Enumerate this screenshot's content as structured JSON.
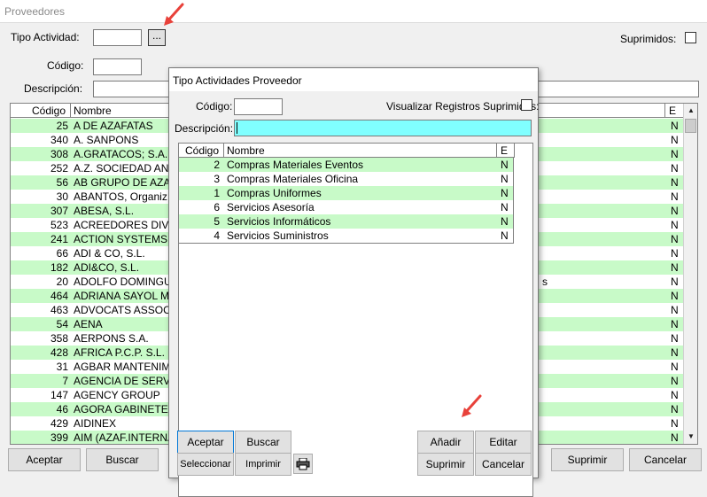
{
  "window": {
    "title": "Proveedores"
  },
  "filters": {
    "tipo_actividad_label": "Tipo Actividad:",
    "tipo_actividad_value": "",
    "browse_label": "...",
    "suprimidos_label": "Suprimidos:",
    "codigo_label": "Código:",
    "codigo_value": "",
    "descripcion_label": "Descripción:",
    "descripcion_value": ""
  },
  "grid": {
    "headers": {
      "codigo": "Código",
      "nombre": "Nombre",
      "e": "E"
    },
    "right_fragment": "s",
    "rows": [
      {
        "codigo": "25",
        "nombre": "A DE AZAFATAS",
        "e": "N"
      },
      {
        "codigo": "340",
        "nombre": "A. SANPONS",
        "e": "N"
      },
      {
        "codigo": "308",
        "nombre": "A.GRATACOS; S.A.",
        "e": "N"
      },
      {
        "codigo": "252",
        "nombre": "A.Z. SOCIEDAD AN",
        "e": "N"
      },
      {
        "codigo": "56",
        "nombre": "AB GRUPO DE AZA",
        "e": "N"
      },
      {
        "codigo": "30",
        "nombre": "ABANTOS, Organiz",
        "e": "N"
      },
      {
        "codigo": "307",
        "nombre": "ABESA, S.L.",
        "e": "N"
      },
      {
        "codigo": "523",
        "nombre": "ACREEDORES DIVE",
        "e": "N"
      },
      {
        "codigo": "241",
        "nombre": "ACTION SYSTEMS,",
        "e": "N"
      },
      {
        "codigo": "66",
        "nombre": "ADI & CO, S.L.",
        "e": "N"
      },
      {
        "codigo": "182",
        "nombre": "ADI&CO, S.L.",
        "e": "N"
      },
      {
        "codigo": "20",
        "nombre": "ADOLFO DOMINGU",
        "e": "N"
      },
      {
        "codigo": "464",
        "nombre": "ADRIANA SAYOL M",
        "e": "N"
      },
      {
        "codigo": "463",
        "nombre": "ADVOCATS ASSOC",
        "e": "N"
      },
      {
        "codigo": "54",
        "nombre": "AENA",
        "e": "N"
      },
      {
        "codigo": "358",
        "nombre": "AERPONS S.A.",
        "e": "N"
      },
      {
        "codigo": "428",
        "nombre": "AFRICA P.C.P. S.L.",
        "e": "N"
      },
      {
        "codigo": "31",
        "nombre": "AGBAR MANTENIMI",
        "e": "N"
      },
      {
        "codigo": "7",
        "nombre": "AGENCIA DE SERV",
        "e": "N"
      },
      {
        "codigo": "147",
        "nombre": "AGENCY GROUP",
        "e": "N"
      },
      {
        "codigo": "46",
        "nombre": "AGORA GABINETE",
        "e": "N"
      },
      {
        "codigo": "429",
        "nombre": "AIDINEX",
        "e": "N"
      },
      {
        "codigo": "399",
        "nombre": "AIM (AZAF.INTERNA",
        "e": "N"
      }
    ]
  },
  "main_buttons": {
    "aceptar": "Aceptar",
    "buscar": "Buscar",
    "suprimir": "Suprimir",
    "cancelar": "Cancelar"
  },
  "dialog": {
    "title": "Tipo Actividades Proveedor",
    "codigo_label": "Código:",
    "codigo_value": "",
    "visualizar_label": "Visualizar Registros Suprimidos:",
    "descripcion_label": "Descripción:",
    "descripcion_value": "",
    "headers": {
      "codigo": "Código",
      "nombre": "Nombre",
      "e": "E"
    },
    "rows": [
      {
        "codigo": "2",
        "nombre": "Compras Materiales Eventos",
        "e": "N"
      },
      {
        "codigo": "3",
        "nombre": "Compras Materiales Oficina",
        "e": "N"
      },
      {
        "codigo": "1",
        "nombre": "Compras Uniformes",
        "e": "N"
      },
      {
        "codigo": "6",
        "nombre": "Servicios Asesoría",
        "e": "N"
      },
      {
        "codigo": "5",
        "nombre": "Servicios Informáticos",
        "e": "N"
      },
      {
        "codigo": "4",
        "nombre": "Servicios Suministros",
        "e": "N"
      }
    ],
    "buttons": {
      "aceptar": "Aceptar",
      "buscar": "Buscar",
      "seleccionar": "Seleccionar",
      "imprimir": "Imprimir",
      "anadir": "Añadir",
      "editar": "Editar",
      "suprimir": "Suprimir",
      "cancelar": "Cancelar"
    }
  },
  "colors": {
    "row_highlight": "#c8fac8",
    "active_input": "#80ffff",
    "annotation_arrow": "#e8413a"
  },
  "icons": {
    "print": "printer-icon",
    "arrow": "annotation-arrow-icon"
  }
}
